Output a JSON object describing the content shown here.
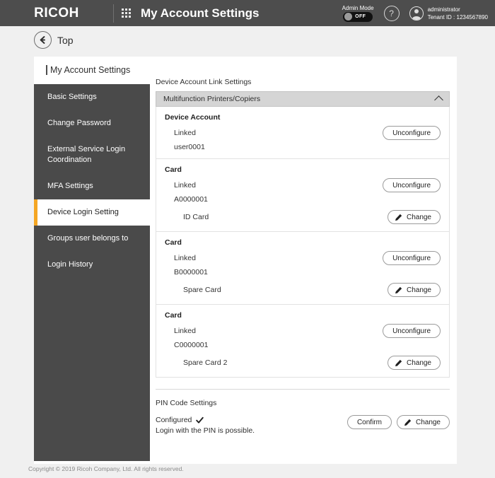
{
  "header": {
    "brand": "RICOH",
    "apps_icon": "grid-apps-icon",
    "title": "My Account Settings",
    "admin_mode_label": "Admin Mode",
    "admin_mode_state": "OFF",
    "help_icon": "question-mark-icon",
    "user_name": "administrator",
    "tenant": "Tenant ID : 1234567890"
  },
  "breadcrumb": {
    "back_icon": "back-arrow-icon",
    "label": "Top"
  },
  "panel": {
    "title": "My Account Settings"
  },
  "sidebar": {
    "items": [
      {
        "label": "Basic Settings",
        "active": false
      },
      {
        "label": "Change Password",
        "active": false
      },
      {
        "label": "External Service Login Coordination",
        "active": false
      },
      {
        "label": "MFA Settings",
        "active": false
      },
      {
        "label": "Device Login Setting",
        "active": true
      },
      {
        "label": "Groups user belongs to",
        "active": false
      },
      {
        "label": "Login History",
        "active": false
      }
    ]
  },
  "main": {
    "section_label": "Device Account Link Settings",
    "accordion": {
      "title": "Multifunction Printers/Copiers",
      "expanded": true,
      "chevron_icon": "chevron-up-icon"
    },
    "groups": [
      {
        "title": "Device Account",
        "status": "Linked",
        "value": "user0001",
        "action_label": "Unconfigure",
        "sub": null,
        "sub_action_label": null
      },
      {
        "title": "Card",
        "status": "Linked",
        "value": "A0000001",
        "action_label": "Unconfigure",
        "sub": "ID Card",
        "sub_action_label": "Change"
      },
      {
        "title": "Card",
        "status": "Linked",
        "value": "B0000001",
        "action_label": "Unconfigure",
        "sub": "Spare Card",
        "sub_action_label": "Change"
      },
      {
        "title": "Card",
        "status": "Linked",
        "value": "C0000001",
        "action_label": "Unconfigure",
        "sub": "Spare Card 2",
        "sub_action_label": "Change"
      }
    ],
    "pin": {
      "label": "PIN Code Settings",
      "status": "Configured",
      "status_icon": "checkmark-icon",
      "description": "Login with the PIN is possible.",
      "confirm_label": "Confirm",
      "change_label": "Change"
    }
  },
  "footer": {
    "copyright": "Copyright © 2019 Ricoh Company, Ltd. All rights reserved."
  },
  "colors": {
    "header_bg": "#4d4d4d",
    "sidebar_bg": "#4a4a4a",
    "accent": "#f5a623",
    "accordion_bg": "#d5d5d5"
  }
}
